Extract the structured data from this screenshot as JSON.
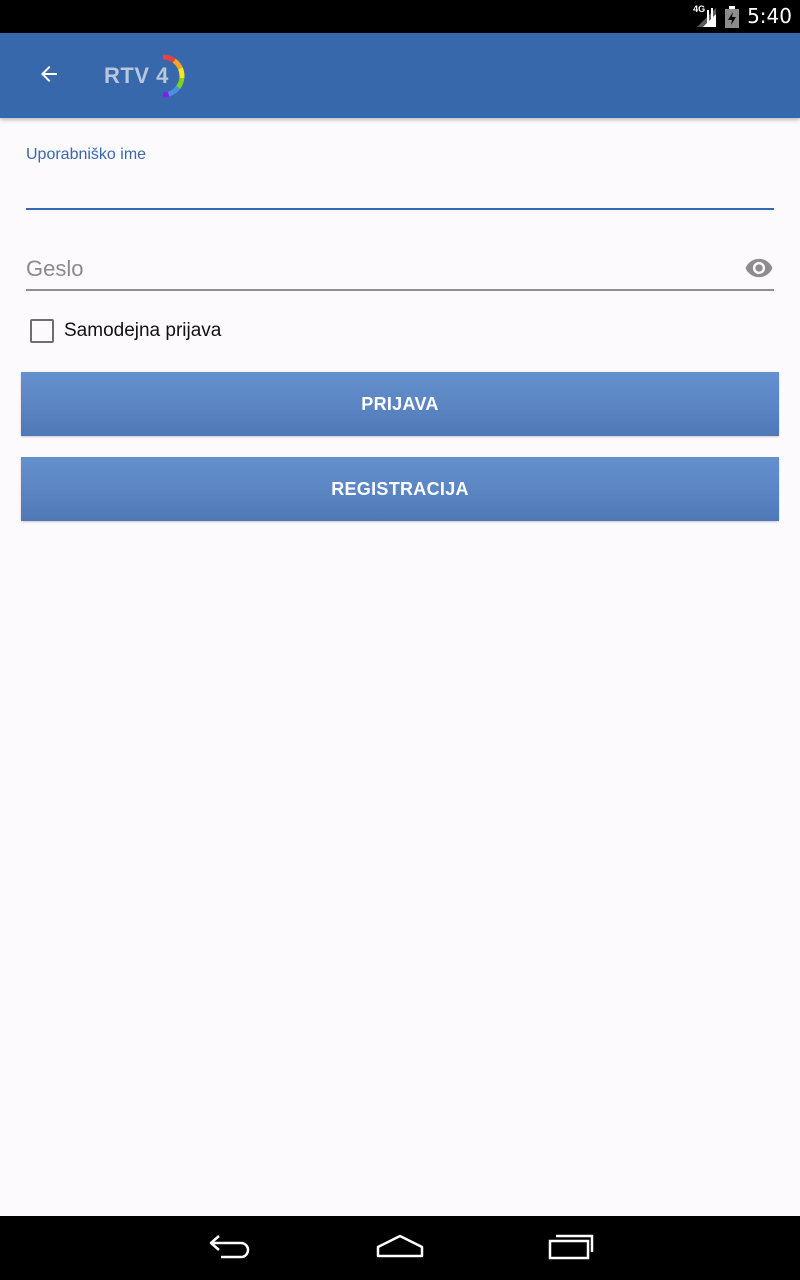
{
  "status_bar": {
    "network_type": "4G",
    "time": "5:40",
    "icons": [
      "signal-icon",
      "battery-icon"
    ]
  },
  "app_bar": {
    "back_icon": "arrow-left-icon",
    "logo_text": "RTV 4",
    "background": "#3768AC"
  },
  "form": {
    "username": {
      "label": "Uporabniško ime",
      "value": ""
    },
    "password": {
      "placeholder": "Geslo",
      "value": "",
      "toggle_icon": "eye-icon"
    },
    "auto_login": {
      "label": "Samodejna prijava",
      "checked": false
    },
    "login_button": "PRIJAVA",
    "register_button": "REGISTRACIJA"
  },
  "nav_bar": {
    "icons": [
      "back-icon",
      "home-icon",
      "recents-icon"
    ]
  },
  "colors": {
    "accent": "#3768AC",
    "button": "#5A84C2",
    "background": "#FDFAFE"
  }
}
